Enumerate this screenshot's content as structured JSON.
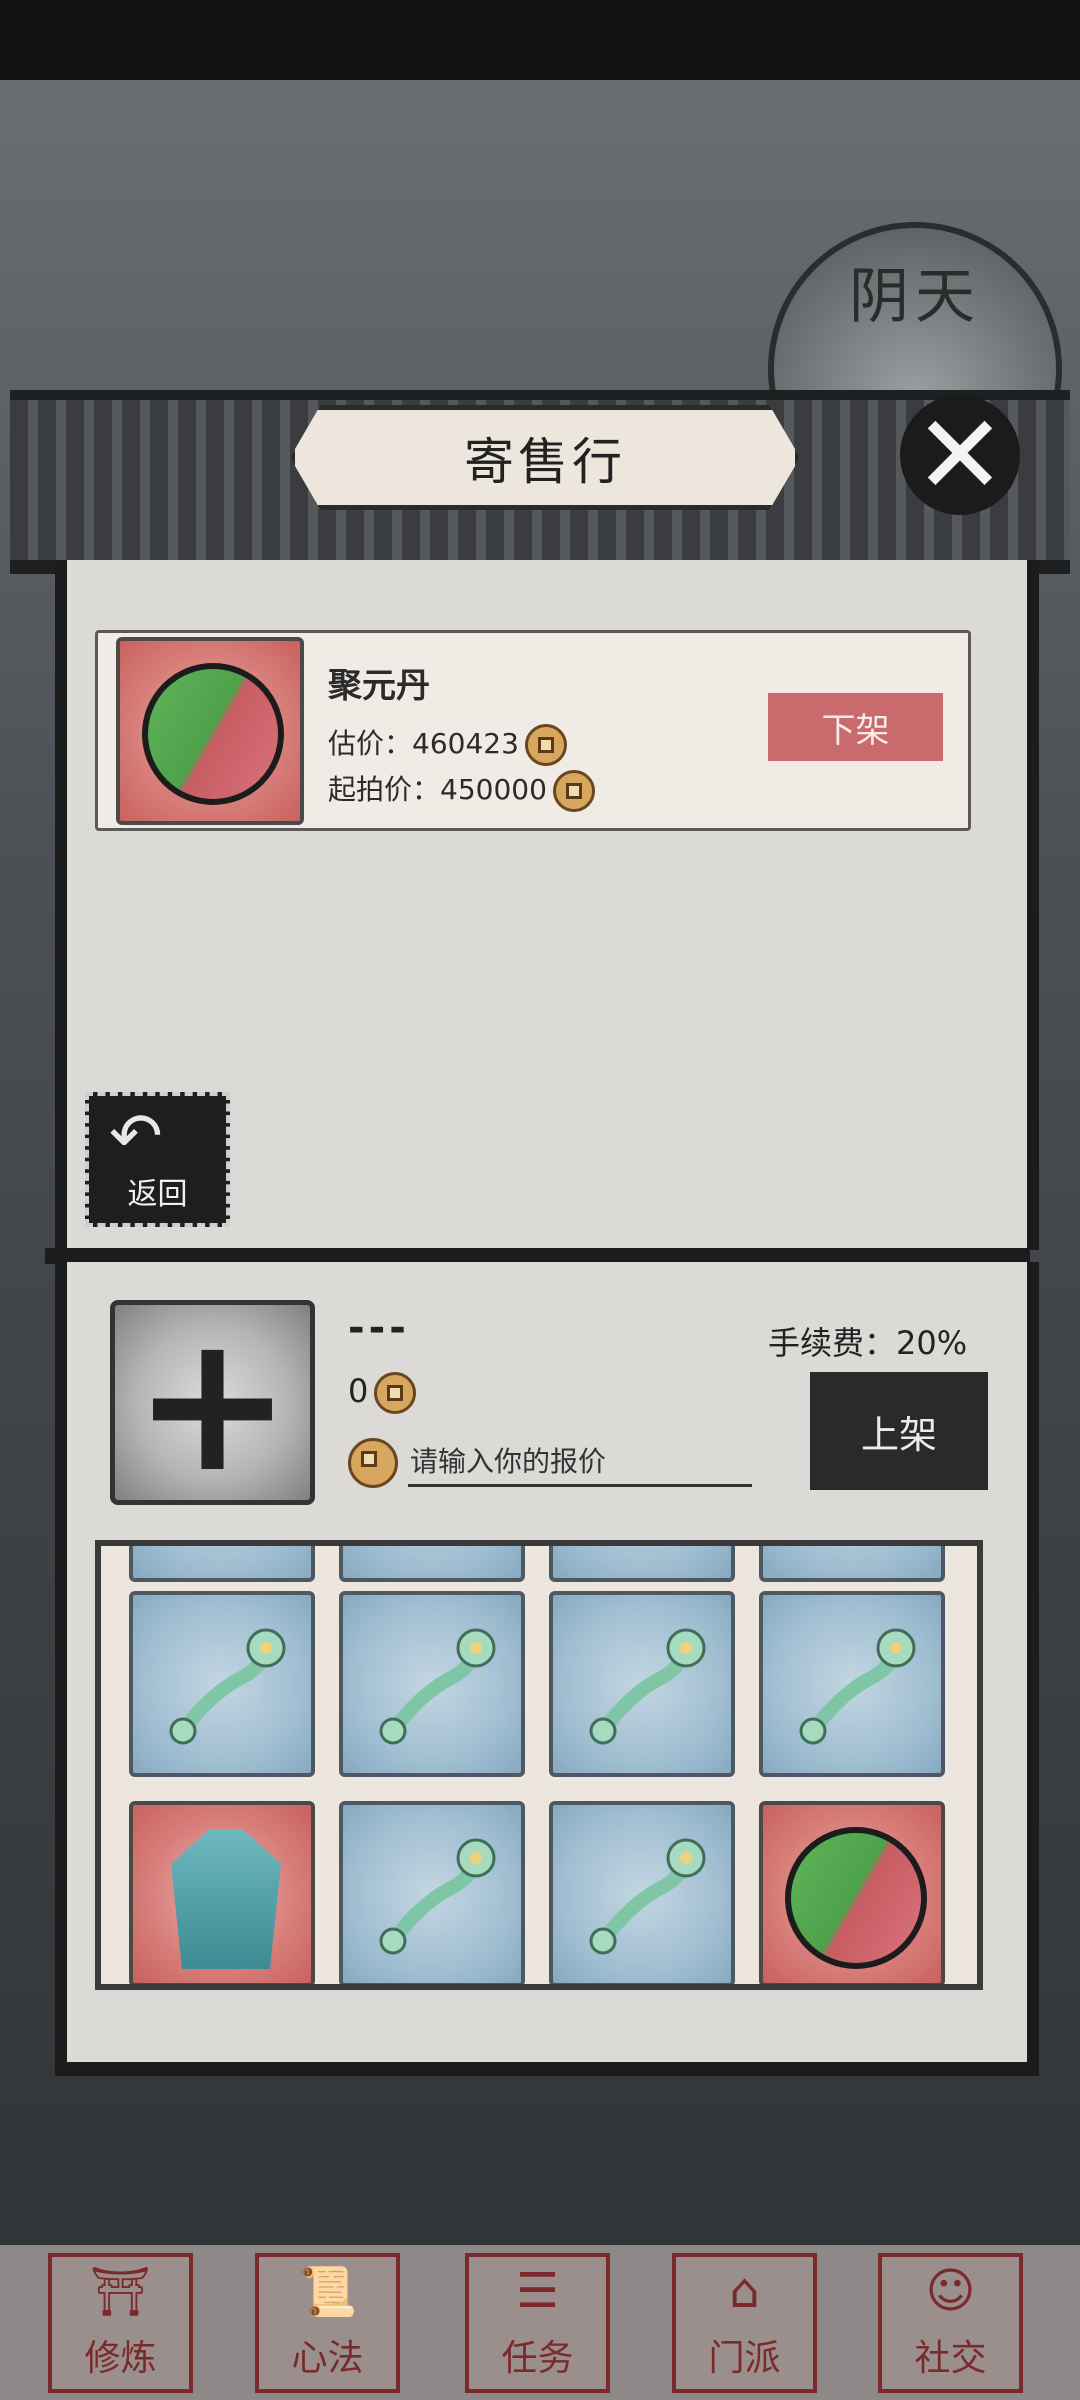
{
  "weather": {
    "label": "阴天"
  },
  "window": {
    "title": "寄售行"
  },
  "listing": {
    "item_name": "聚元丹",
    "estimate_label": "估价：460423",
    "start_price_label": "起拍价：450000",
    "delist_label": "下架"
  },
  "back_label": "返回",
  "sell": {
    "selected_name": "---",
    "selected_value": "0",
    "price_placeholder": "请输入你的报价",
    "fee_label": "手续费：20%",
    "list_label": "上架"
  },
  "inventory": {
    "rows": [
      [
        "ruyi",
        "ruyi",
        "ruyi",
        "ruyi"
      ],
      [
        "robe",
        "ruyi",
        "ruyi",
        "pill"
      ]
    ]
  },
  "nav": {
    "items": [
      "修炼",
      "心法",
      "任务",
      "门派",
      "社交"
    ]
  },
  "colors": {
    "red_slot": "#d77d79",
    "blue_slot": "#9fbdd1",
    "delist_button": "#c96a6c",
    "list_button": "#2a2a2a"
  }
}
